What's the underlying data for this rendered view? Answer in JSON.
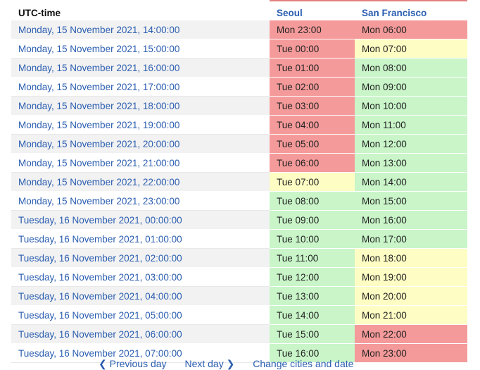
{
  "header": {
    "utc_label": "UTC-time",
    "city1": "Seoul",
    "city2": "San Francisco"
  },
  "colors": {
    "red": "#f59a9a",
    "yellow": "#fdfdc4",
    "green": "#c9f5c9",
    "link": "#2a5db0"
  },
  "rows": [
    {
      "utc": "Monday, 15 November 2021, 14:00:00",
      "seoul": "Mon 23:00",
      "seoul_status": "red",
      "sf": "Mon 06:00",
      "sf_status": "red"
    },
    {
      "utc": "Monday, 15 November 2021, 15:00:00",
      "seoul": "Tue 00:00",
      "seoul_status": "red",
      "sf": "Mon 07:00",
      "sf_status": "yellow"
    },
    {
      "utc": "Monday, 15 November 2021, 16:00:00",
      "seoul": "Tue 01:00",
      "seoul_status": "red",
      "sf": "Mon 08:00",
      "sf_status": "green"
    },
    {
      "utc": "Monday, 15 November 2021, 17:00:00",
      "seoul": "Tue 02:00",
      "seoul_status": "red",
      "sf": "Mon 09:00",
      "sf_status": "green"
    },
    {
      "utc": "Monday, 15 November 2021, 18:00:00",
      "seoul": "Tue 03:00",
      "seoul_status": "red",
      "sf": "Mon 10:00",
      "sf_status": "green"
    },
    {
      "utc": "Monday, 15 November 2021, 19:00:00",
      "seoul": "Tue 04:00",
      "seoul_status": "red",
      "sf": "Mon 11:00",
      "sf_status": "green"
    },
    {
      "utc": "Monday, 15 November 2021, 20:00:00",
      "seoul": "Tue 05:00",
      "seoul_status": "red",
      "sf": "Mon 12:00",
      "sf_status": "green"
    },
    {
      "utc": "Monday, 15 November 2021, 21:00:00",
      "seoul": "Tue 06:00",
      "seoul_status": "red",
      "sf": "Mon 13:00",
      "sf_status": "green"
    },
    {
      "utc": "Monday, 15 November 2021, 22:00:00",
      "seoul": "Tue 07:00",
      "seoul_status": "yellow",
      "sf": "Mon 14:00",
      "sf_status": "green"
    },
    {
      "utc": "Monday, 15 November 2021, 23:00:00",
      "seoul": "Tue 08:00",
      "seoul_status": "green",
      "sf": "Mon 15:00",
      "sf_status": "green"
    },
    {
      "utc": "Tuesday, 16 November 2021, 00:00:00",
      "seoul": "Tue 09:00",
      "seoul_status": "green",
      "sf": "Mon 16:00",
      "sf_status": "green"
    },
    {
      "utc": "Tuesday, 16 November 2021, 01:00:00",
      "seoul": "Tue 10:00",
      "seoul_status": "green",
      "sf": "Mon 17:00",
      "sf_status": "green"
    },
    {
      "utc": "Tuesday, 16 November 2021, 02:00:00",
      "seoul": "Tue 11:00",
      "seoul_status": "green",
      "sf": "Mon 18:00",
      "sf_status": "yellow"
    },
    {
      "utc": "Tuesday, 16 November 2021, 03:00:00",
      "seoul": "Tue 12:00",
      "seoul_status": "green",
      "sf": "Mon 19:00",
      "sf_status": "yellow"
    },
    {
      "utc": "Tuesday, 16 November 2021, 04:00:00",
      "seoul": "Tue 13:00",
      "seoul_status": "green",
      "sf": "Mon 20:00",
      "sf_status": "yellow"
    },
    {
      "utc": "Tuesday, 16 November 2021, 05:00:00",
      "seoul": "Tue 14:00",
      "seoul_status": "green",
      "sf": "Mon 21:00",
      "sf_status": "yellow"
    },
    {
      "utc": "Tuesday, 16 November 2021, 06:00:00",
      "seoul": "Tue 15:00",
      "seoul_status": "green",
      "sf": "Mon 22:00",
      "sf_status": "red"
    },
    {
      "utc": "Tuesday, 16 November 2021, 07:00:00",
      "seoul": "Tue 16:00",
      "seoul_status": "green",
      "sf": "Mon 23:00",
      "sf_status": "red"
    }
  ],
  "pager": {
    "prev": "❮ Previous day",
    "next": "Next day ❯",
    "change": "Change cities and date"
  }
}
